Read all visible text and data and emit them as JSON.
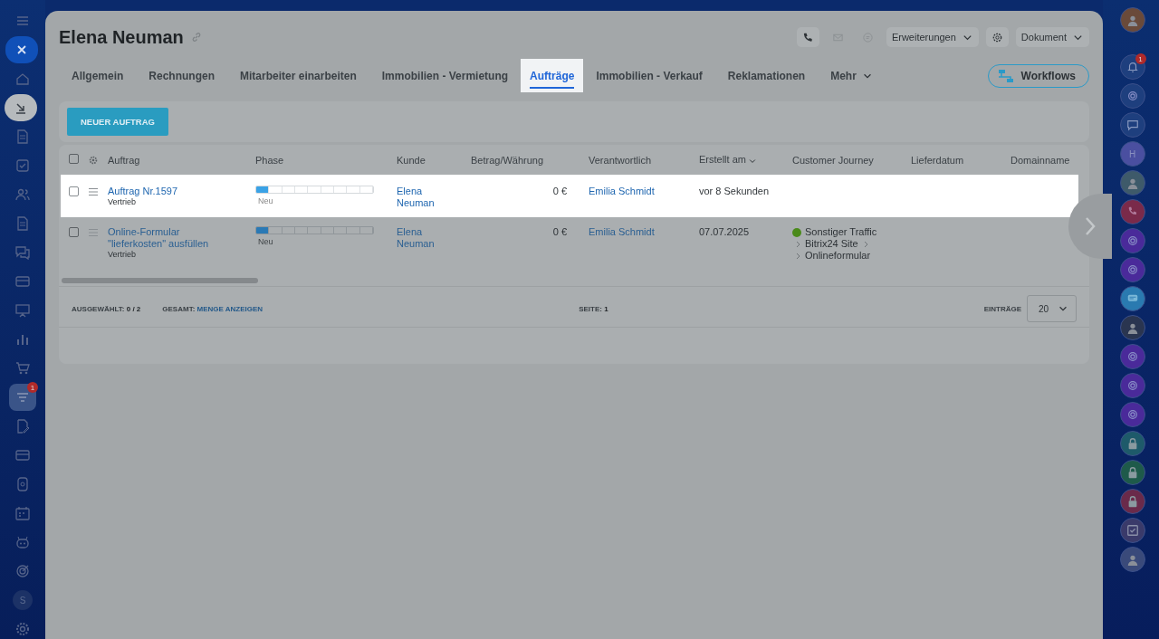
{
  "left_sidebar": {
    "items": [
      {
        "kind": "menu",
        "selected": false
      },
      {
        "kind": "close"
      },
      {
        "kind": "home",
        "selected": false
      },
      {
        "kind": "collapse"
      },
      {
        "kind": "doc",
        "selected": false
      },
      {
        "kind": "check",
        "selected": false
      },
      {
        "kind": "people",
        "selected": false
      },
      {
        "kind": "doc",
        "selected": false
      },
      {
        "kind": "chat",
        "selected": false
      },
      {
        "kind": "card",
        "selected": false
      },
      {
        "kind": "board",
        "selected": false
      },
      {
        "kind": "chart",
        "selected": false
      },
      {
        "kind": "cart",
        "selected": false
      },
      {
        "kind": "filter",
        "selected": true,
        "badge": "1"
      },
      {
        "kind": "edit",
        "selected": false
      },
      {
        "kind": "card",
        "selected": false
      },
      {
        "kind": "box",
        "selected": false
      },
      {
        "kind": "calendar",
        "selected": false
      },
      {
        "kind": "robot",
        "selected": false
      },
      {
        "kind": "target",
        "selected": false
      },
      {
        "kind": "letter",
        "text": "S"
      },
      {
        "kind": "gear",
        "selected": false
      }
    ]
  },
  "header": {
    "title": "Elena Neuman",
    "extensions": "Erweiterungen",
    "document": "Dokument"
  },
  "tabs": [
    {
      "label": "Allgemein",
      "selected": false
    },
    {
      "label": "Rechnungen",
      "selected": false
    },
    {
      "label": "Mitarbeiter einarbeiten",
      "selected": false
    },
    {
      "label": "Immobilien - Vermietung",
      "selected": false
    },
    {
      "label": "Aufträge",
      "selected": true
    },
    {
      "label": "Immobilien - Verkauf",
      "selected": false
    },
    {
      "label": "Reklamationen",
      "selected": false
    },
    {
      "label": "Mehr",
      "selected": false,
      "kind": "dropdown"
    }
  ],
  "workflows": "Workflows",
  "new_button": "NEUER AUFTRAG",
  "table": {
    "select_all_checked": false,
    "columns": [
      "Auftrag",
      "Phase",
      "Kunde",
      "Betrag/Währung",
      "Verantwortlich",
      "Erstellt am",
      "Customer Journey",
      "Lieferdatum",
      "Domainname"
    ],
    "rows": [
      {
        "highlighted": true,
        "checked": false,
        "title": "Auftrag Nr.1597",
        "subtitle": "Vertrieb",
        "phase": {
          "level": 0.111,
          "label": "Neu"
        },
        "customer": "Elena Neuman",
        "amount": "0 €",
        "responsible": "Emilia Schmidt",
        "created": "vor 8 Sekunden",
        "journey": []
      },
      {
        "highlighted": false,
        "checked": false,
        "title": "Online-Formular \"lieferkosten\" ausfüllen",
        "subtitle": "Vertrieb",
        "phase": {
          "level": 0.111,
          "label": "Neu"
        },
        "customer": "Elena Neuman",
        "amount": "0 €",
        "responsible": "Emilia Schmidt",
        "created": "07.07.2025",
        "journey": [
          "Sonstiger Traffic",
          "Bitrix24 Site",
          "Onlineformular"
        ]
      }
    ]
  },
  "footer": {
    "selected_label": "AUSGEWÄHLT:",
    "selected_value": "0 / 2",
    "total_label": "GESAMT:",
    "total_link": "MENGE ANZEIGEN",
    "page_label": "SEITE:",
    "page_value": "1",
    "entries_label": "EINTRÄGE",
    "entries_value": "20"
  },
  "right_sidebar": {
    "items": [
      {
        "kind": "avatar",
        "color": "#6a4a3a"
      },
      {
        "kind": "bell",
        "color": "#1e3f7e",
        "badge": "1"
      },
      {
        "kind": "ring",
        "color": "#1e3f7e"
      },
      {
        "kind": "chat",
        "color": "#1e3f7e"
      },
      {
        "kind": "letter",
        "color": "#4a4fa0",
        "text": "H"
      },
      {
        "kind": "avatar",
        "color": "#3e5a6a"
      },
      {
        "kind": "phone",
        "color": "#7a2a4a"
      },
      {
        "kind": "ring",
        "color": "#4a2a9a"
      },
      {
        "kind": "ring",
        "color": "#4a2a9a"
      },
      {
        "kind": "bubble",
        "color": "#2a7ab0"
      },
      {
        "kind": "avatar",
        "color": "#2a3550"
      },
      {
        "kind": "ring",
        "color": "#4a2a9a"
      },
      {
        "kind": "ring",
        "color": "#4a2a9a"
      },
      {
        "kind": "ring",
        "color": "#4a2a9a"
      },
      {
        "kind": "lock",
        "color": "#1e5a6a"
      },
      {
        "kind": "lock",
        "color": "#1e5a4a"
      },
      {
        "kind": "lock",
        "color": "#6a2a4a"
      },
      {
        "kind": "task",
        "color": "#3a3a6a"
      },
      {
        "kind": "avatar",
        "color": "#3a4a7a"
      }
    ]
  }
}
